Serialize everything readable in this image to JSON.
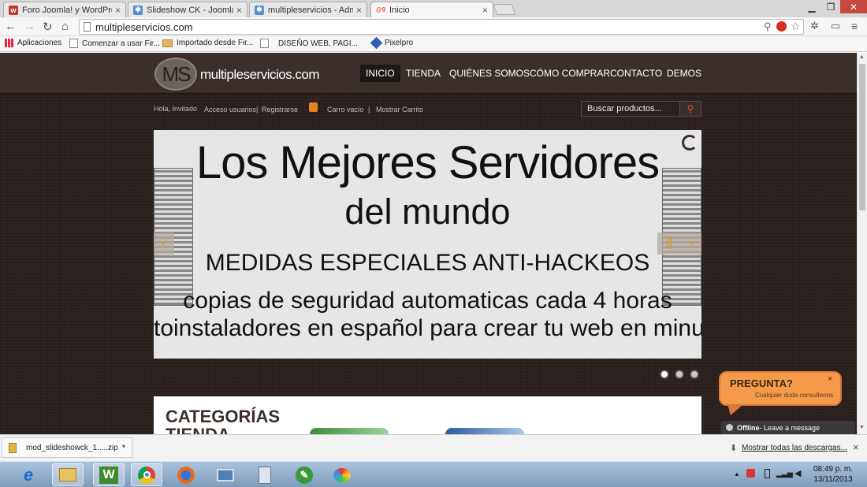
{
  "browser": {
    "tabs": [
      {
        "title": "Foro Joomla! y WordPress",
        "favicon": "w",
        "color": "#c0392b"
      },
      {
        "title": "Slideshow CK - Joomla! Ex",
        "favicon": "joomla",
        "color": "#5a8fd0"
      },
      {
        "title": "multipleservicios - Admin",
        "favicon": "joomla",
        "color": "#5a8fd0"
      },
      {
        "title": "Inicio",
        "favicon": "ms",
        "color": "#e74c3c"
      }
    ],
    "url": "multipleservicios.com",
    "bookmarks": [
      {
        "label": "Aplicaciones",
        "icon": "apps-icon"
      },
      {
        "label": "Comenzar a usar Fir...",
        "icon": "page-icon"
      },
      {
        "label": "Importado desde Fir...",
        "icon": "folder-icon"
      },
      {
        "label": "DISEÑO WEB, PAGI...",
        "icon": "page-icon"
      },
      {
        "label": "Pixelpro",
        "icon": "pixelpro-icon"
      }
    ]
  },
  "site": {
    "logo_mark": "MS",
    "logo_text": "multipleservicios.com",
    "menu": [
      {
        "label": "INICIO",
        "active": true
      },
      {
        "label": "TIENDA",
        "active": false
      },
      {
        "label": "QUIÉNES SOMOS",
        "active": false
      },
      {
        "label": "CÓMO COMPRAR",
        "active": false
      },
      {
        "label": "CONTACTO",
        "active": false
      },
      {
        "label": "DEMOS",
        "active": false
      }
    ],
    "greeting": "Hola, Invitado",
    "login_link": "Acceso usuarios",
    "register_link": "Registrarse",
    "cart_status": "Carro vacío",
    "show_cart": "Mostrar Carrito",
    "search_placeholder": "Buscar productos...",
    "slide": {
      "line1": "Los Mejores Servidores",
      "line2": "del mundo",
      "line3": "MEDIDAS ESPECIALES ANTI-HACKEOS",
      "line4": "copias de seguridad automaticas cada 4 horas",
      "line5": "toinstaladores en español para crear tu web en minuto"
    },
    "slide_dots": 3,
    "categories_title": "CATEGORÍAS",
    "categories_sub": "TIENDA"
  },
  "chat": {
    "title": "PREGUNTA?",
    "subtitle": "Cualquier duda consultenos.",
    "status_label": "Offline",
    "status_text": " - Leave a message"
  },
  "downloads": {
    "file": "mod_slideshowck_1.....zip",
    "show_all": "Mostrar todas las descargas..."
  },
  "taskbar": {
    "time": "08:49 p. m.",
    "date": "13/11/2013"
  }
}
